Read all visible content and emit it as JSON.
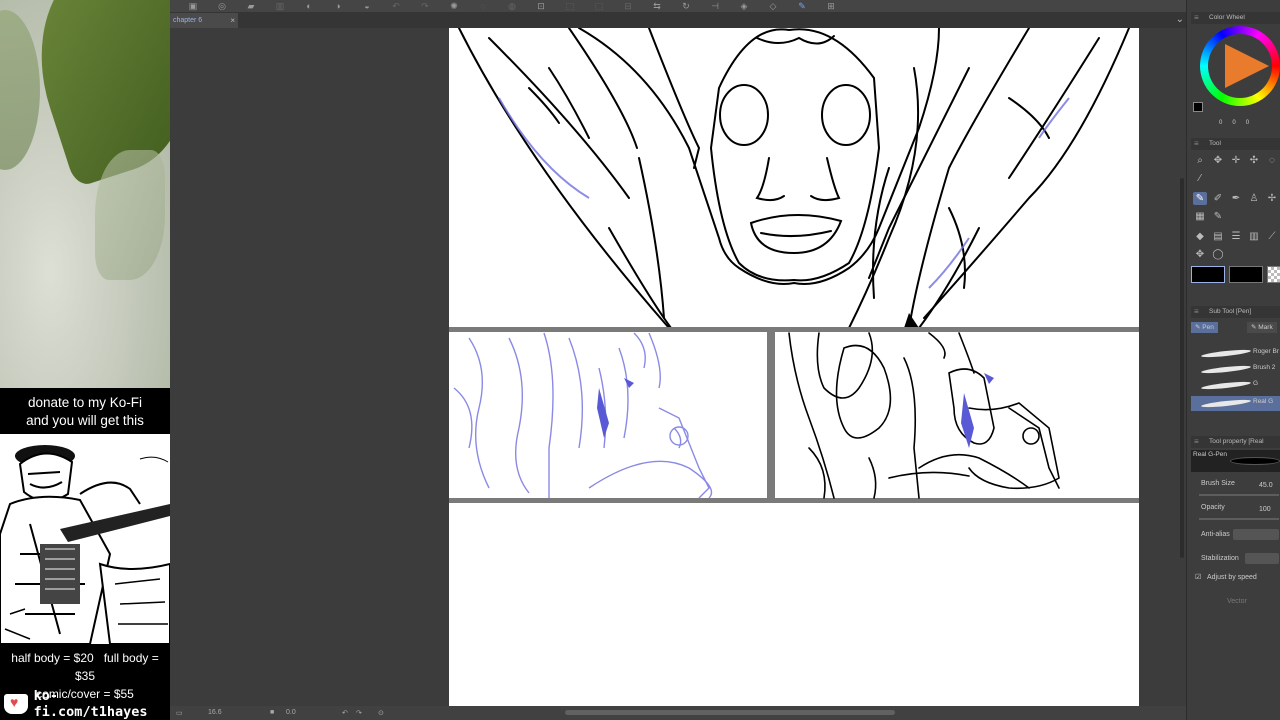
{
  "overlay": {
    "ad_line1": "donate to my Ko-Fi",
    "ad_line2": "and you will get this",
    "price_half": "half body = $20",
    "price_full": "full body = $35",
    "price_comic": "comic/cover = $55",
    "kofi_url": "ko-fi.com/t1hayes"
  },
  "toolbar": {
    "icons": [
      "home",
      "new",
      "open",
      "save",
      "save-as",
      "undo",
      "redo",
      "clear",
      "fill",
      "transform",
      "select-all",
      "deselect",
      "crop",
      "flip",
      "rotate",
      "pen",
      "eraser",
      "select",
      "lasso",
      "hand",
      "settings"
    ]
  },
  "tabs": {
    "document": "chapter 6",
    "close": "×",
    "menu": "⌄"
  },
  "status": {
    "zoom": "16.6",
    "angle": "0.0"
  },
  "panels": {
    "color_wheel_title": "Color Wheel",
    "color_values": [
      "0",
      "0",
      "0"
    ],
    "tool_title": "Tool",
    "subtool_title": "Sub Tool [Pen]",
    "subtool_tab1": "Pen",
    "subtool_tab2": "Mark",
    "brushes": [
      {
        "name": "Roger Br"
      },
      {
        "name": "Brush 2"
      },
      {
        "name": "G"
      },
      {
        "name": "G"
      },
      {
        "name": "Real G"
      }
    ],
    "toolprop_title": "Tool property [Real",
    "preview_name": "Real G-Pen",
    "brush_size_label": "Brush Size",
    "brush_size_value": "45.0",
    "opacity_label": "Opacity",
    "opacity_value": "100",
    "antialias_label": "Anti-alias",
    "stabilization_label": "Stabilization",
    "adjust_label": "Adjust by speed",
    "vector_label": "Vector"
  },
  "colors": {
    "main_color": "#000000",
    "sub_color": "#000000",
    "accent": "#5b6f9c",
    "sketch_blue": "#6f6fe0"
  }
}
